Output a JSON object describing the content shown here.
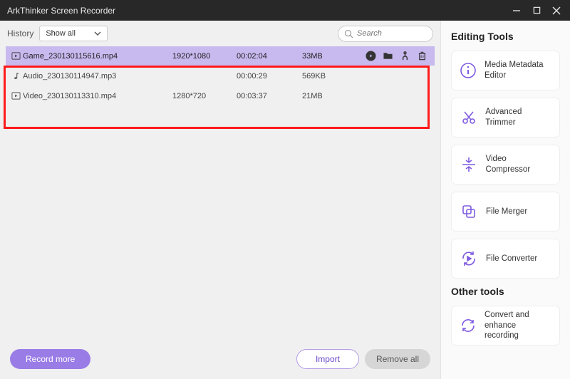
{
  "window": {
    "title": "ArkThinker Screen Recorder"
  },
  "history": {
    "label": "History",
    "filter": "Show all",
    "search_placeholder": "Search"
  },
  "files": [
    {
      "name": "Game_230130115616.mp4",
      "res": "1920*1080",
      "dur": "00:02:04",
      "size": "33MB",
      "kind": "video",
      "selected": true
    },
    {
      "name": "Audio_230130114947.mp3",
      "res": "",
      "dur": "00:00:29",
      "size": "569KB",
      "kind": "audio",
      "selected": false
    },
    {
      "name": "Video_230130113310.mp4",
      "res": "1280*720",
      "dur": "00:03:37",
      "size": "21MB",
      "kind": "video",
      "selected": false
    }
  ],
  "footer": {
    "record": "Record more",
    "import": "Import",
    "removeall": "Remove all"
  },
  "sidebar": {
    "editing_heading": "Editing Tools",
    "tools": [
      {
        "label": "Media Metadata Editor"
      },
      {
        "label": "Advanced Trimmer"
      },
      {
        "label": "Video Compressor"
      },
      {
        "label": "File Merger"
      },
      {
        "label": "File Converter"
      }
    ],
    "other_heading": "Other tools",
    "others": [
      {
        "label": "Convert and enhance recording"
      }
    ]
  }
}
